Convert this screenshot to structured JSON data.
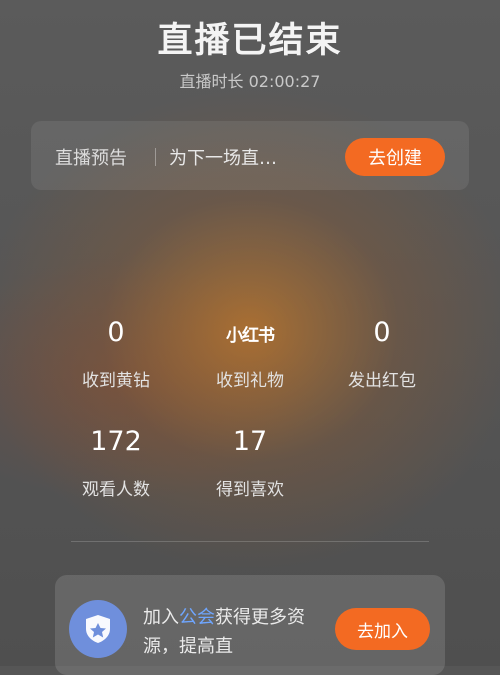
{
  "header": {
    "title": "直播已结束",
    "duration": "直播时长 02:00:27"
  },
  "preview": {
    "label": "直播预告",
    "input_text": "为下一场直…",
    "create_button": "去创建"
  },
  "stats": {
    "yellow_diamonds": {
      "value": "0",
      "label": "收到黄钻"
    },
    "gifts": {
      "value": "小红书",
      "label": "收到礼物"
    },
    "red_packets": {
      "value": "0",
      "label": "发出红包"
    },
    "viewers": {
      "value": "172",
      "label": "观看人数"
    },
    "likes": {
      "value": "17",
      "label": "得到喜欢"
    }
  },
  "guild": {
    "text_before": "加入",
    "link": "公会",
    "text_after": "获得更多资源，提高直",
    "join_button": "去加入"
  },
  "colors": {
    "accent": "#f36a22",
    "link": "#6fa6ff",
    "icon_bg": "#6f8fdc"
  },
  "icons": {
    "guild": "shield-icon"
  }
}
